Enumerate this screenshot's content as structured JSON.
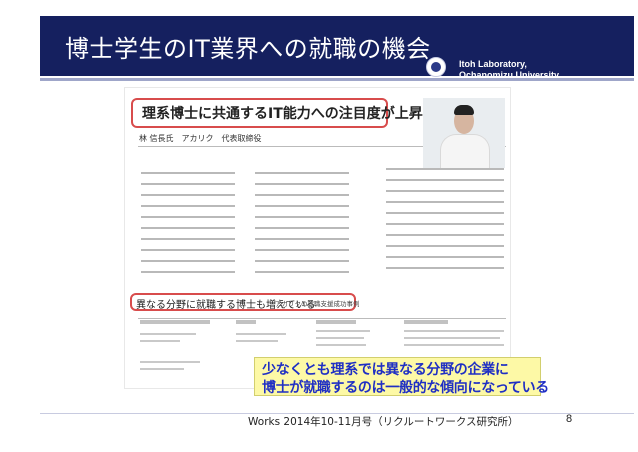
{
  "slide": {
    "title": "博士学生のIT業界への就職の機会",
    "lab_line1": "Itoh Laboratory,",
    "lab_line2": "Ochanomizu University",
    "page_number": "8"
  },
  "article": {
    "header": "理系博士に共通するIT能力への注目度が上昇",
    "author": "林 信長氏　アカリク　代表取締役",
    "subheader": "異なる分野に就職する博士も増えている",
    "subheader_note": "アカリクの就職支援成功事例"
  },
  "highlight": {
    "line1": "少なくとも理系では異なる分野の企業に",
    "line2": "博士が就職するのは一般的な傾向になっている"
  },
  "source": "Works 2014年10-11月号（リクルートワークス研究所）",
  "colors": {
    "title_bar": "#15205f",
    "highlight_bg": "#fdf9a6",
    "highlight_text": "#1f2fc4",
    "frame_red": "#d84c4c"
  }
}
